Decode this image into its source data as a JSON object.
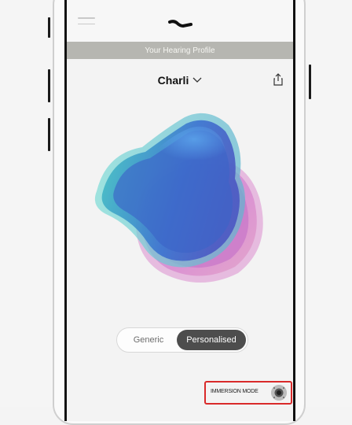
{
  "profile_banner": "Your Hearing Profile",
  "user": {
    "name": "Charli"
  },
  "mode_toggle": {
    "options": [
      "Generic",
      "Personalised"
    ],
    "selected": "Personalised"
  },
  "immersion": {
    "label": "IMMERSION MODE"
  },
  "icons": {
    "menu": "hamburger-menu-icon",
    "logo": "wave-logo-icon",
    "chevron": "chevron-down-icon",
    "share": "share-icon",
    "immersion": "immersion-mode-icon"
  },
  "colors": {
    "banner": "#b6b6b1",
    "toggle_active": "#4d4d4d",
    "highlight": "#d92a2a",
    "blob_blue": "#3f78d2",
    "blob_teal": "#3fc0c0",
    "blob_pink": "#d980c8"
  }
}
